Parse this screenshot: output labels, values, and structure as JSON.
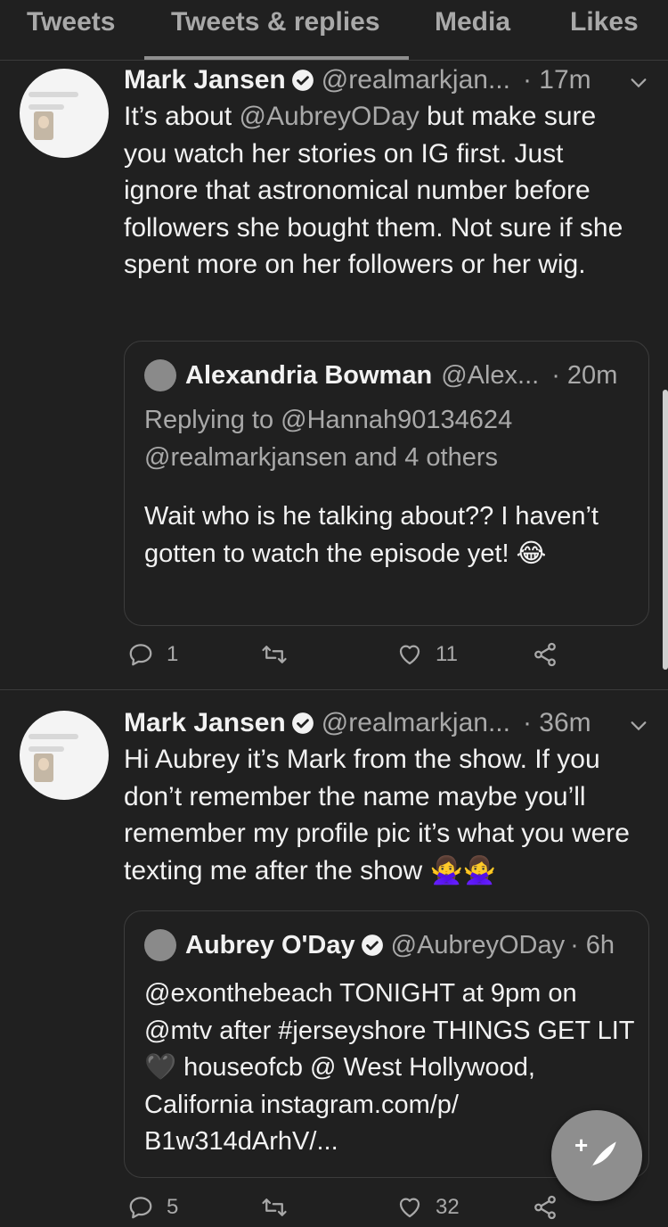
{
  "tabs": [
    {
      "label": "Tweets"
    },
    {
      "label": "Tweets & replies"
    },
    {
      "label": "Media"
    },
    {
      "label": "Likes"
    }
  ],
  "tweets": [
    {
      "name": "Mark Jansen",
      "handle": "@realmarkjan...",
      "time": "· 17m",
      "text_mention": "@AubreyODay",
      "text_before": "It’s about ",
      "text_after": " but make sure you watch her stories on IG first. Just ignore that astronomical number before followers she bought them. Not sure if she spent more on her followers or her wig.",
      "quote": {
        "name": "Alexandria Bowman",
        "handle": "@Alex...",
        "time": "· 20m",
        "reply_line": "Replying to @Hannah90134624 @realmarkjansen and 4 others",
        "text": "Wait who is he talking about?? I haven’t gotten to watch the episode yet! 😂"
      },
      "replies": "1",
      "retweets": "",
      "likes": "11"
    },
    {
      "name": "Mark Jansen",
      "handle": "@realmarkjan...",
      "time": "· 36m",
      "text": "Hi Aubrey it’s Mark from the show. If you don’t remember the name maybe you’ll remember my profile pic it’s what you were texting me after the show 🙅‍♀️🙅‍♀️",
      "quote": {
        "name": "Aubrey O'Day",
        "handle": "@AubreyODay",
        "time": "· 6h",
        "text": "@exonthebeach TONIGHT at 9pm on @mtv after #jerseyshore THINGS GET LIT 🖤 houseofcb @ West Hollywood, California instagram.com/p/ B1w314dArhV/..."
      },
      "replies": "5",
      "retweets": "",
      "likes": "32"
    }
  ],
  "colors": {
    "background": "#202020",
    "text": "#f2f2f2",
    "muted": "#a9a9a9",
    "fab": "#8e8e8e"
  },
  "icons": [
    "verified-badge-icon",
    "chevron-down-icon",
    "reply-icon",
    "retweet-icon",
    "like-icon",
    "share-icon",
    "compose-tweet-icon"
  ]
}
